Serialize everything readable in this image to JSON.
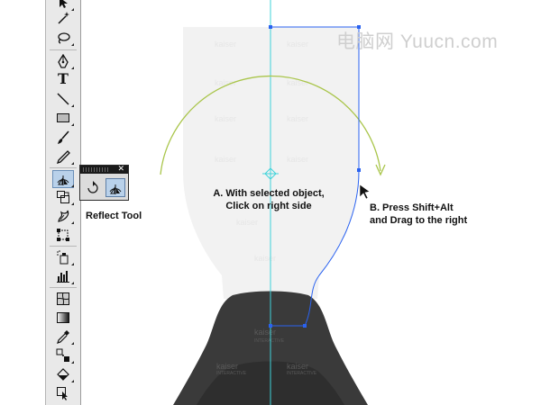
{
  "watermark": {
    "text": "电脑网 Yuucn.com"
  },
  "tooltip_label": "Reflect Tool",
  "instructions": {
    "step_a": [
      "A. With selected object,",
      "Click on right side"
    ],
    "step_b": [
      "B. Press Shift+Alt",
      "and Drag to the right"
    ]
  },
  "artwork": {
    "kaiser_text": "kaiser",
    "interactive_text": "INTERACTIVE"
  },
  "toolbar": {
    "tools": [
      "selection-tool",
      "magic-wand-tool",
      "lasso-tool",
      "pen-tool",
      "type-tool",
      "line-segment-tool",
      "rectangle-tool",
      "paintbrush-tool",
      "pencil-tool",
      "rotate-tool",
      "scale-tool",
      "warp-tool",
      "free-transform-tool",
      "symbol-sprayer-tool",
      "column-graph-tool",
      "mesh-tool",
      "gradient-tool",
      "eyedropper-tool",
      "blend-tool",
      "live-paint-bucket-tool",
      "live-paint-selection-tool"
    ],
    "type_glyph": "T"
  },
  "popout": {
    "close_glyph": "✕",
    "tools": [
      "rotate-tool",
      "reflect-tool"
    ]
  },
  "colors": {
    "guide": "#3fd3d9",
    "path": "#2a62f0",
    "arc": "#a9c54a",
    "bottle_light": "#f2f2f2",
    "bottle_dark": "#3a3a3a",
    "bottle_darker": "#2e2e2e"
  }
}
